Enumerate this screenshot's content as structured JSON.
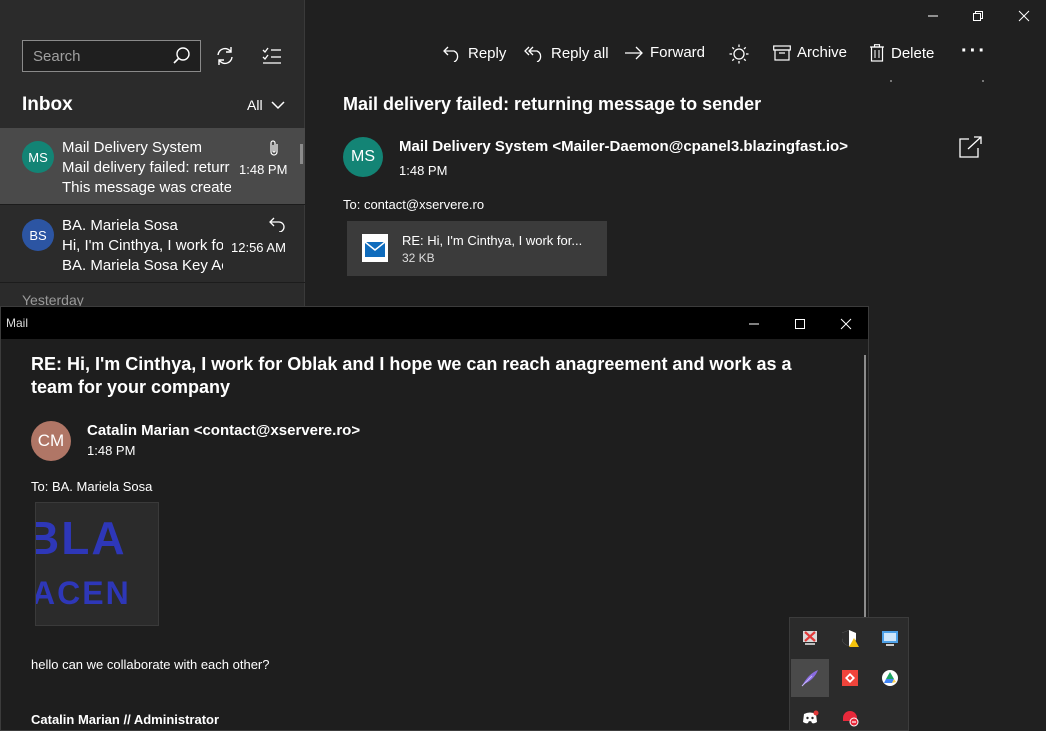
{
  "sidebar": {
    "search": {
      "placeholder": "Search",
      "icon": "search-icon"
    },
    "sync_icon": "sync-icon",
    "select_icon": "select-mode-icon",
    "inbox_title": "Inbox",
    "filter_label": "All",
    "section_yesterday": "Yesterday",
    "messages": [
      {
        "initials": "MS",
        "avatar_color": "#138475",
        "from": "Mail Delivery System",
        "subject": "Mail delivery failed: returr",
        "preview": "This message was createc",
        "time": "1:48 PM",
        "indicator": "paperclip-icon"
      },
      {
        "initials": "BS",
        "avatar_color": "#2c55a3",
        "from": "BA. Mariela Sosa",
        "subject": "Hi, I'm Cinthya, I work fo",
        "preview": "BA. Mariela Sosa Key Acc",
        "time": "12:56 AM",
        "indicator": "reply-icon"
      }
    ]
  },
  "toolbar": {
    "reply": "Reply",
    "reply_all": "Reply all",
    "forward": "Forward",
    "archive": "Archive",
    "delete": "Delete"
  },
  "reading": {
    "subject": "Mail delivery failed: returning message to sender",
    "initials": "MS",
    "avatar_color": "#138475",
    "sender": "Mail Delivery System  <Mailer-Daemon@cpanel3.blazingfast.io>",
    "time": "1:48 PM",
    "to": "To: contact@xservere.ro",
    "attachment": {
      "name": "RE: Hi, I'm Cinthya, I work for...",
      "size": "32 KB"
    }
  },
  "popup": {
    "title": "Mail",
    "subject": "RE: Hi, I'm Cinthya, I work for Oblak and I hope we can reach anagreement and work as a team for your company",
    "initials": "CM",
    "avatar_color": "#b07666",
    "sender": "Catalin Marian <contact@xservere.ro>",
    "time": "1:48 PM",
    "to": "To: BA. Mariela Sosa",
    "image_text_1": "BLA",
    "image_text_2": "ACEN",
    "body": "hello can we collaborate with each other?",
    "signature": "Catalin Marian // Administrator"
  },
  "tray_icons": [
    "network-off-icon",
    "shield-warning-icon",
    "remote-desktop-icon",
    "feather-icon",
    "anydesk-icon",
    "google-drive-icon",
    "discord-icon",
    "vpn-icon"
  ],
  "colors": {
    "background": "#202020",
    "pane": "#2b2b2b",
    "selected": "#4a4a4a"
  }
}
